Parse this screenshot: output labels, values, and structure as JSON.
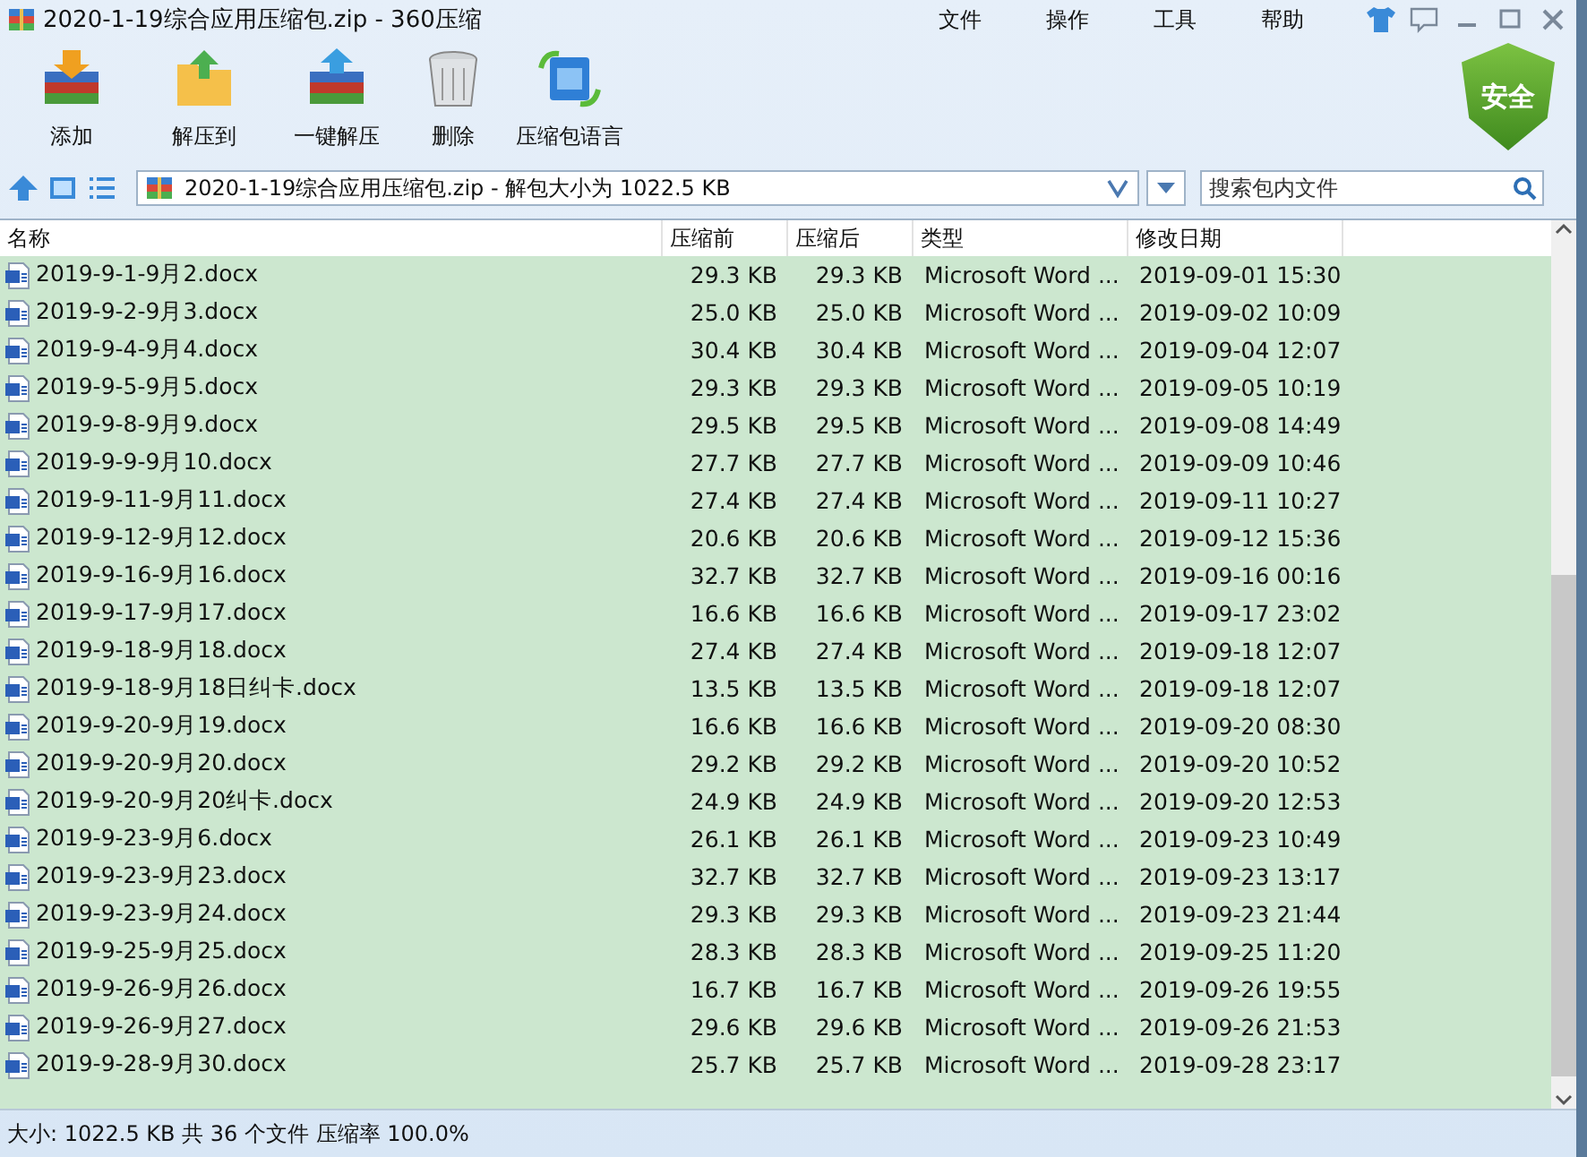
{
  "window": {
    "title": "2020-1-19综合应用压缩包.zip - 360压缩"
  },
  "menu": [
    "文件",
    "操作",
    "工具",
    "帮助"
  ],
  "toolbar": [
    {
      "kind": "add",
      "label": "添加"
    },
    {
      "kind": "extract",
      "label": "解压到"
    },
    {
      "kind": "oneclick",
      "label": "一键解压"
    },
    {
      "kind": "delete",
      "label": "删除"
    },
    {
      "kind": "language",
      "label": "压缩包语言"
    }
  ],
  "security_badge": "安全",
  "address": {
    "value": "2020-1-19综合应用压缩包.zip - 解包大小为 1022.5 KB"
  },
  "search": {
    "placeholder": "搜索包内文件"
  },
  "table": {
    "columns": [
      "名称",
      "压缩前",
      "压缩后",
      "类型",
      "修改日期"
    ],
    "rows": [
      [
        "2019-9-1-9月2.docx",
        "29.3 KB",
        "29.3 KB",
        "Microsoft Word ...",
        "2019-09-01 15:30"
      ],
      [
        "2019-9-2-9月3.docx",
        "25.0 KB",
        "25.0 KB",
        "Microsoft Word ...",
        "2019-09-02 10:09"
      ],
      [
        "2019-9-4-9月4.docx",
        "30.4 KB",
        "30.4 KB",
        "Microsoft Word ...",
        "2019-09-04 12:07"
      ],
      [
        "2019-9-5-9月5.docx",
        "29.3 KB",
        "29.3 KB",
        "Microsoft Word ...",
        "2019-09-05 10:19"
      ],
      [
        "2019-9-8-9月9.docx",
        "29.5 KB",
        "29.5 KB",
        "Microsoft Word ...",
        "2019-09-08 14:49"
      ],
      [
        "2019-9-9-9月10.docx",
        "27.7 KB",
        "27.7 KB",
        "Microsoft Word ...",
        "2019-09-09 10:46"
      ],
      [
        "2019-9-11-9月11.docx",
        "27.4 KB",
        "27.4 KB",
        "Microsoft Word ...",
        "2019-09-11 10:27"
      ],
      [
        "2019-9-12-9月12.docx",
        "20.6 KB",
        "20.6 KB",
        "Microsoft Word ...",
        "2019-09-12 15:36"
      ],
      [
        "2019-9-16-9月16.docx",
        "32.7 KB",
        "32.7 KB",
        "Microsoft Word ...",
        "2019-09-16 00:16"
      ],
      [
        "2019-9-17-9月17.docx",
        "16.6 KB",
        "16.6 KB",
        "Microsoft Word ...",
        "2019-09-17 23:02"
      ],
      [
        "2019-9-18-9月18.docx",
        "27.4 KB",
        "27.4 KB",
        "Microsoft Word ...",
        "2019-09-18 12:07"
      ],
      [
        "2019-9-18-9月18日纠卡.docx",
        "13.5 KB",
        "13.5 KB",
        "Microsoft Word ...",
        "2019-09-18 12:07"
      ],
      [
        "2019-9-20-9月19.docx",
        "16.6 KB",
        "16.6 KB",
        "Microsoft Word ...",
        "2019-09-20 08:30"
      ],
      [
        "2019-9-20-9月20.docx",
        "29.2 KB",
        "29.2 KB",
        "Microsoft Word ...",
        "2019-09-20 10:52"
      ],
      [
        "2019-9-20-9月20纠卡.docx",
        "24.9 KB",
        "24.9 KB",
        "Microsoft Word ...",
        "2019-09-20 12:53"
      ],
      [
        "2019-9-23-9月6.docx",
        "26.1 KB",
        "26.1 KB",
        "Microsoft Word ...",
        "2019-09-23 10:49"
      ],
      [
        "2019-9-23-9月23.docx",
        "32.7 KB",
        "32.7 KB",
        "Microsoft Word ...",
        "2019-09-23 13:17"
      ],
      [
        "2019-9-23-9月24.docx",
        "29.3 KB",
        "29.3 KB",
        "Microsoft Word ...",
        "2019-09-23 21:44"
      ],
      [
        "2019-9-25-9月25.docx",
        "28.3 KB",
        "28.3 KB",
        "Microsoft Word ...",
        "2019-09-25 11:20"
      ],
      [
        "2019-9-26-9月26.docx",
        "16.7 KB",
        "16.7 KB",
        "Microsoft Word ...",
        "2019-09-26 19:55"
      ],
      [
        "2019-9-26-9月27.docx",
        "29.6 KB",
        "29.6 KB",
        "Microsoft Word ...",
        "2019-09-26 21:53"
      ],
      [
        "2019-9-28-9月30.docx",
        "25.7 KB",
        "25.7 KB",
        "Microsoft Word ...",
        "2019-09-28 23:17"
      ]
    ]
  },
  "status_bar": "大小: 1022.5 KB 共 36 个文件 压缩率 100.0%"
}
